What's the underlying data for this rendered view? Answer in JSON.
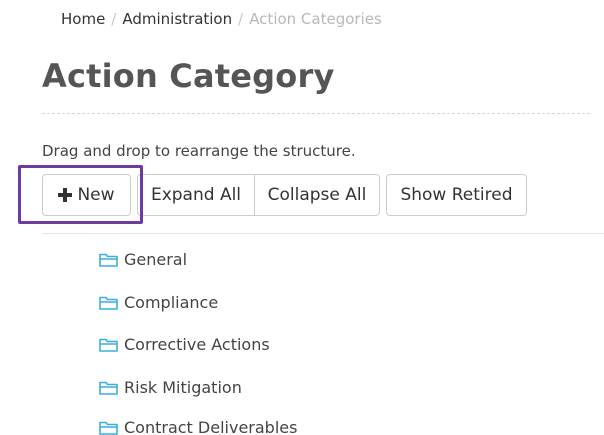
{
  "breadcrumb": {
    "home": "Home",
    "administration": "Administration",
    "current": "Action Categories"
  },
  "page": {
    "title": "Action Category",
    "instructions": "Drag and drop to rearrange the structure."
  },
  "toolbar": {
    "new_label": "New",
    "expand_all_label": "Expand All",
    "collapse_all_label": "Collapse All",
    "show_retired_label": "Show Retired"
  },
  "tree": {
    "items": [
      {
        "label": "General",
        "icon": "folder-icon"
      },
      {
        "label": "Compliance",
        "icon": "folder-icon"
      },
      {
        "label": "Corrective Actions",
        "icon": "folder-icon"
      },
      {
        "label": "Risk Mitigation",
        "icon": "folder-icon"
      },
      {
        "label": "Contract Deliverables",
        "icon": "folder-icon"
      }
    ]
  },
  "colors": {
    "folder_icon": "#3aaee0",
    "highlight": "#6e3aa0",
    "title": "#555555",
    "breadcrumb_current": "#b8b8b8"
  }
}
